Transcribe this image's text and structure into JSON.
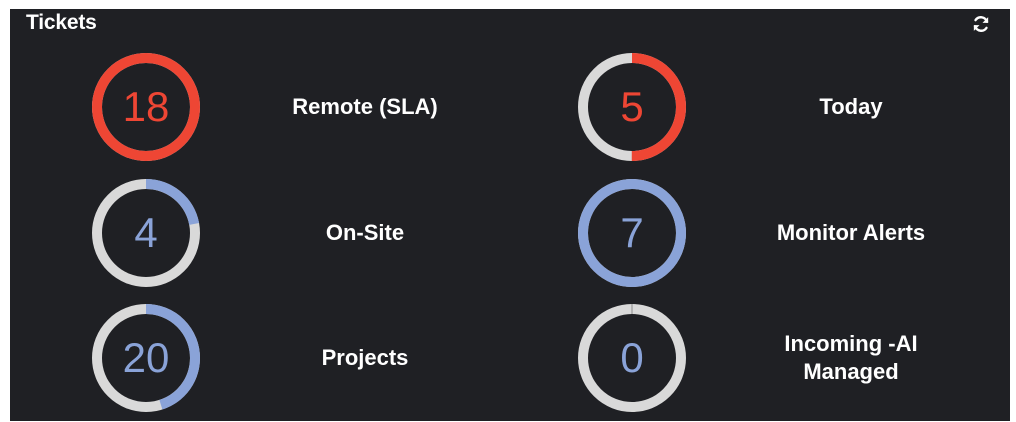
{
  "widget": {
    "title": "Tickets",
    "refresh_icon": "refresh-icon"
  },
  "colors": {
    "background": "#1f2024",
    "track": "#d9d9d9",
    "alert": "#ee4634",
    "info": "#8aa3d8"
  },
  "tiles": [
    {
      "id": "remote-sla",
      "label": "Remote (SLA)",
      "count": "18",
      "fraction": 1.0,
      "color": "#ee4634"
    },
    {
      "id": "today",
      "label": "Today",
      "count": "5",
      "fraction": 0.5,
      "color": "#ee4634"
    },
    {
      "id": "on-site",
      "label": "On-Site",
      "count": "4",
      "fraction": 0.22,
      "color": "#8aa3d8"
    },
    {
      "id": "monitor-alerts",
      "label": "Monitor Alerts",
      "count": "7",
      "fraction": 1.0,
      "color": "#8aa3d8"
    },
    {
      "id": "projects",
      "label": "Projects",
      "count": "20",
      "fraction": 0.45,
      "color": "#8aa3d8"
    },
    {
      "id": "incoming-ai-managed",
      "label": "Incoming -AI Managed",
      "count": "0",
      "fraction": 0.0,
      "color": "#8aa3d8"
    }
  ]
}
